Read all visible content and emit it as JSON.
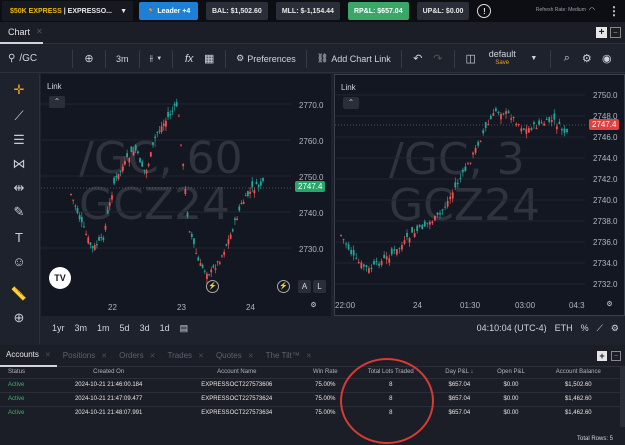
{
  "topbar": {
    "account_prefix": "$50K EXPRESS",
    "account_suffix": "| EXPRESSO...",
    "leader_label": "Leader +4",
    "bal": "BAL: $1,502.60",
    "mll": "MLL: $-1,154.44",
    "rpl": "RP&L: $657.04",
    "upl": "UP&L: $0.00",
    "refresh_rate": "Refresh Rate: Medium",
    "colors": {
      "leader": "#1e7fd6",
      "rpl": "#3aa667",
      "gold": "#f0b90b"
    }
  },
  "tabs": {
    "chart_tab": "Chart"
  },
  "toolbar": {
    "symbol": "/GC",
    "interval": "3m",
    "preferences": "Preferences",
    "add_chart_link": "Add Chart Link",
    "layout_name": "default",
    "layout_save": "Save"
  },
  "left_tools": [
    "crosshair-icon",
    "trendline-icon",
    "fib-icon",
    "pattern-icon",
    "measure-icon",
    "brush-icon",
    "text-icon",
    "emoji-icon",
    "ruler-icon",
    "zoom-in-icon"
  ],
  "pane1": {
    "link_label": "Link",
    "watermark_line1": "/GC, 60",
    "watermark_line2": "GCZ24",
    "price_labels": [
      "2770.0",
      "2760.0",
      "2750.0",
      "2740.0",
      "2730.0"
    ],
    "current_price": "2747.4",
    "time_labels": [
      "22",
      "23",
      "24"
    ],
    "btn_a": "A",
    "btn_l": "L"
  },
  "pane2": {
    "link_label": "Link",
    "watermark_line1": "/GC, 3",
    "watermark_line2": "GCZ24",
    "price_labels": [
      "2750.0",
      "2748.0",
      "2746.0",
      "2744.0",
      "2742.0",
      "2740.0",
      "2738.0",
      "2736.0",
      "2734.0",
      "2732.0"
    ],
    "current_price": "2747.4",
    "time_labels": [
      "22:00",
      "24",
      "01:30",
      "03:00",
      "04:3"
    ]
  },
  "timeframe_bar": {
    "ranges": [
      "1yr",
      "3m",
      "1m",
      "5d",
      "3d",
      "1d"
    ],
    "clock": "04:10:04 (UTC-4)",
    "session": "ETH",
    "percent": "%"
  },
  "panel": {
    "tabs": [
      "Accounts",
      "Positions",
      "Orders",
      "Trades",
      "Quotes",
      "The Tilt™"
    ],
    "columns": [
      "Status",
      "Created On",
      "Account Name",
      "Win Rate",
      "Total Lots Traded",
      "Day P&L",
      "Open P&L",
      "Account Balance"
    ],
    "rows": [
      [
        "Active",
        "2024-10-21 21:46:00.184",
        "EXPRESSOCT227573606",
        "75.00%",
        "8",
        "$657.04",
        "$0.00",
        "$1,502.60"
      ],
      [
        "Active",
        "2024-10-21 21:47:09.477",
        "EXPRESSOCT227573624",
        "75.00%",
        "8",
        "$657.04",
        "$0.00",
        "$1,462.60"
      ],
      [
        "Active",
        "2024-10-21 21:48:07.991",
        "EXPRESSOCT227573634",
        "75.00%",
        "8",
        "$657.04",
        "$0.00",
        "$1,462.60"
      ]
    ],
    "total_rows": "Total Rows: 5",
    "sort_indicator": "↓"
  }
}
